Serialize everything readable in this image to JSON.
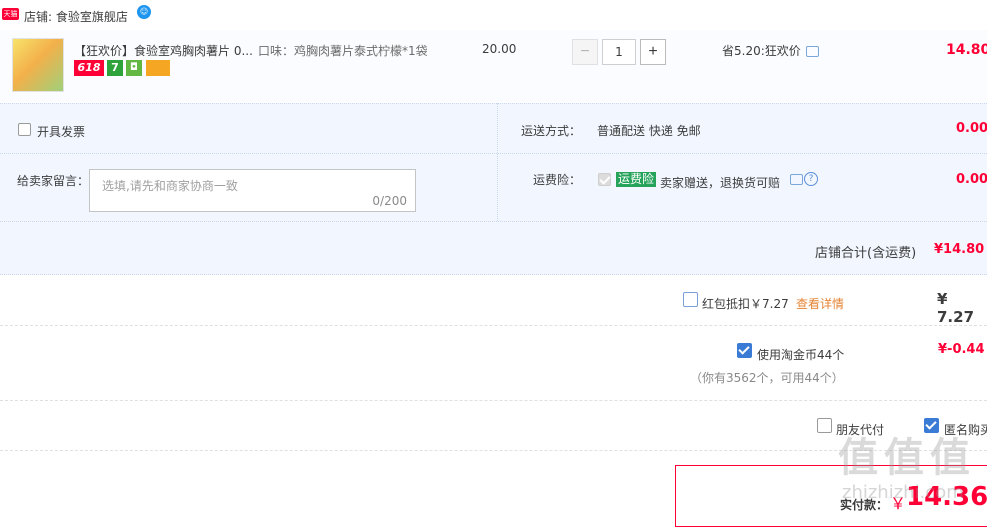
{
  "shop": {
    "badge": "天猫",
    "label": "店铺: 食验室旗舰店"
  },
  "product": {
    "title": "【狂欢价】食验室鸡胸肉薯片 0...",
    "sku": "口味：鸡胸肉薯片泰式柠檬*1袋",
    "price": "20.00",
    "quantity": "1",
    "minus": "−",
    "plus": "+",
    "promo": "省5.20:狂欢价",
    "subtotal": "14.80",
    "tag_618": "618",
    "tag_7": "7"
  },
  "invoice": {
    "label": "开具发票"
  },
  "shipping": {
    "label": "运送方式：",
    "value": "普通配送 快递 免邮",
    "price": "0.00"
  },
  "message": {
    "label": "给卖家留言：",
    "placeholder": "选填,请先和商家协商一致",
    "counter": "0/200"
  },
  "insurance": {
    "label": "运费险：",
    "tag": "运费险",
    "text": "卖家赠送，退换货可赔",
    "price": "0.00"
  },
  "shop_total": {
    "label": "店铺合计(含运费)",
    "value": "¥14.80"
  },
  "redpacket": {
    "label": "红包抵扣￥7.27",
    "link": "查看详情",
    "value": "¥ 7.27",
    "checked": false
  },
  "coins": {
    "label": "使用淘金币44个",
    "note": "（你有3562个，可用44个）",
    "value": "¥-0.44",
    "checked": true
  },
  "options": {
    "friend_pay": "朋友代付",
    "anonymous": "匿名购买"
  },
  "final": {
    "label": "实付款：",
    "currency": "￥",
    "value": "14.36"
  },
  "watermark": "值 值 值",
  "watermark_url": "zhizhizhi.com"
}
